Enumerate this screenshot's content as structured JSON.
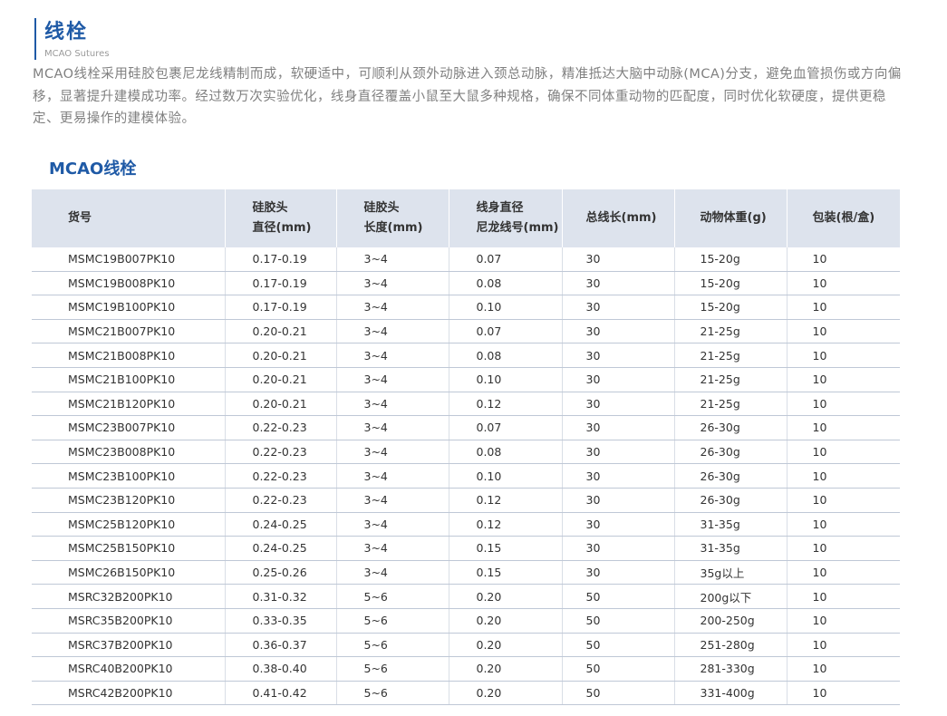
{
  "header": {
    "title": "线栓",
    "subtitle": "MCAO Sutures"
  },
  "intro": "MCAO线栓采用硅胶包裹尼龙线精制而成，软硬适中，可顺利从颈外动脉进入颈总动脉，精准抵达大脑中动脉(MCA)分支，避免血管损伤或方向偏移，显著提升建模成功率。经过数万次实验优化，线身直径覆盖小鼠至大鼠多种规格，确保不同体重动物的匹配度，同时优化软硬度，提供更稳定、更易操作的建模体验。",
  "section_title": "MCAO线栓",
  "table": {
    "headers": [
      "货号",
      "硅胶头\n直径(mm)",
      "硅胶头\n长度(mm)",
      "线身直径\n尼龙线号(mm)",
      "总线长(mm)",
      "动物体重(g)",
      "包装(根/盒)"
    ],
    "rows": [
      [
        "MSMC19B007PK10",
        "0.17-0.19",
        "3~4",
        "0.07",
        "30",
        "15-20g",
        "10"
      ],
      [
        "MSMC19B008PK10",
        "0.17-0.19",
        "3~4",
        "0.08",
        "30",
        "15-20g",
        "10"
      ],
      [
        "MSMC19B100PK10",
        "0.17-0.19",
        "3~4",
        "0.10",
        "30",
        "15-20g",
        "10"
      ],
      [
        "MSMC21B007PK10",
        "0.20-0.21",
        "3~4",
        "0.07",
        "30",
        "21-25g",
        "10"
      ],
      [
        "MSMC21B008PK10",
        "0.20-0.21",
        "3~4",
        "0.08",
        "30",
        "21-25g",
        "10"
      ],
      [
        "MSMC21B100PK10",
        "0.20-0.21",
        "3~4",
        "0.10",
        "30",
        "21-25g",
        "10"
      ],
      [
        "MSMC21B120PK10",
        "0.20-0.21",
        "3~4",
        "0.12",
        "30",
        "21-25g",
        "10"
      ],
      [
        "MSMC23B007PK10",
        "0.22-0.23",
        "3~4",
        "0.07",
        "30",
        "26-30g",
        "10"
      ],
      [
        "MSMC23B008PK10",
        "0.22-0.23",
        "3~4",
        "0.08",
        "30",
        "26-30g",
        "10"
      ],
      [
        "MSMC23B100PK10",
        "0.22-0.23",
        "3~4",
        "0.10",
        "30",
        "26-30g",
        "10"
      ],
      [
        "MSMC23B120PK10",
        "0.22-0.23",
        "3~4",
        "0.12",
        "30",
        "26-30g",
        "10"
      ],
      [
        "MSMC25B120PK10",
        "0.24-0.25",
        "3~4",
        "0.12",
        "30",
        "31-35g",
        "10"
      ],
      [
        "MSMC25B150PK10",
        "0.24-0.25",
        "3~4",
        "0.15",
        "30",
        "31-35g",
        "10"
      ],
      [
        "MSMC26B150PK10",
        "0.25-0.26",
        "3~4",
        "0.15",
        "30",
        "35g以上",
        "10"
      ],
      [
        "MSRC32B200PK10",
        "0.31-0.32",
        "5~6",
        "0.20",
        "50",
        "200g以下",
        "10"
      ],
      [
        "MSRC35B200PK10",
        "0.33-0.35",
        "5~6",
        "0.20",
        "50",
        "200-250g",
        "10"
      ],
      [
        "MSRC37B200PK10",
        "0.36-0.37",
        "5~6",
        "0.20",
        "50",
        "251-280g",
        "10"
      ],
      [
        "MSRC40B200PK10",
        "0.38-0.40",
        "5~6",
        "0.20",
        "50",
        "281-330g",
        "10"
      ],
      [
        "MSRC42B200PK10",
        "0.41-0.42",
        "5~6",
        "0.20",
        "50",
        "331-400g",
        "10"
      ]
    ]
  }
}
